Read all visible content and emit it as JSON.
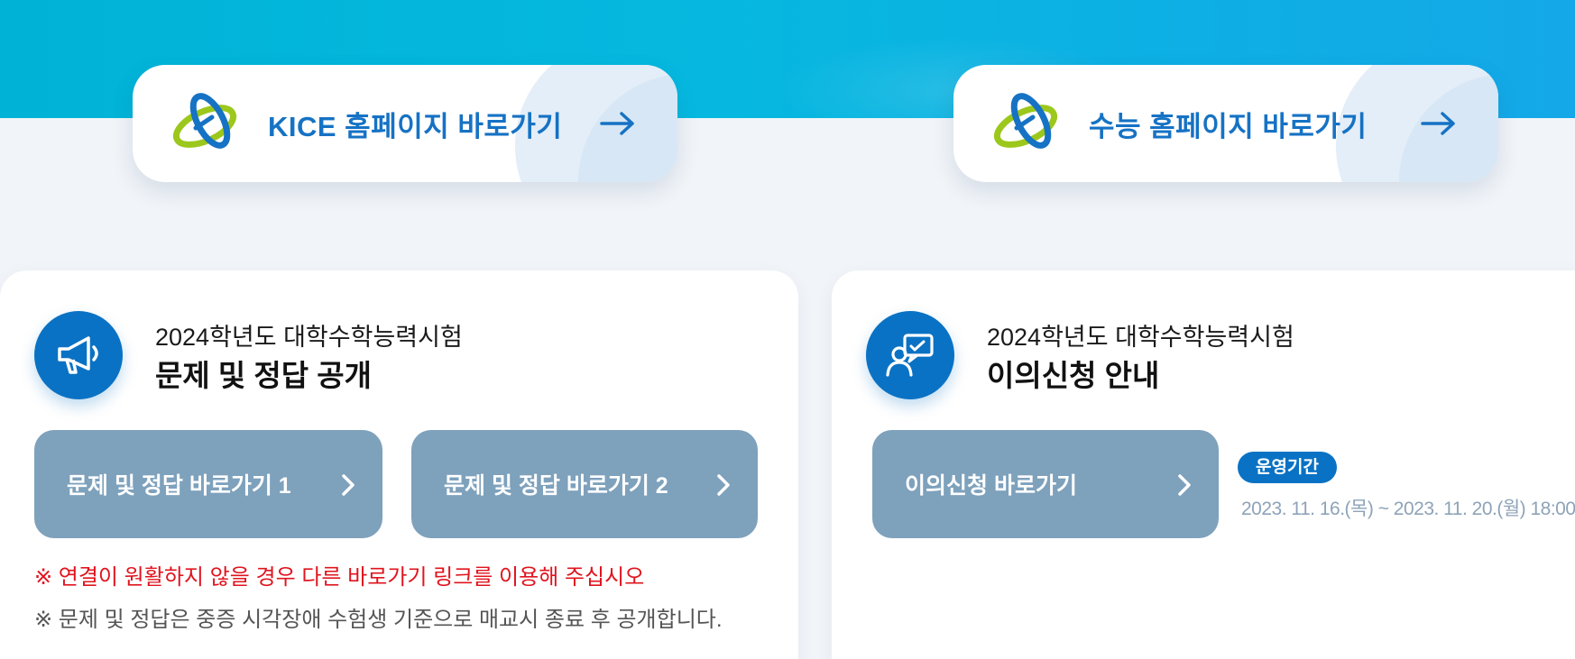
{
  "top_links": [
    {
      "label": "KICE 홈페이지 바로가기",
      "icon": "kice-logo-icon"
    },
    {
      "label": "수능 홈페이지 바로가기",
      "icon": "kice-logo-icon"
    }
  ],
  "panels": {
    "answers": {
      "subtitle": "2024학년도 대학수학능력시험",
      "title": "문제 및 정답 공개",
      "icon": "megaphone-icon",
      "buttons": [
        {
          "label": "문제 및 정답 바로가기 1"
        },
        {
          "label": "문제 및 정답 바로가기 2"
        }
      ],
      "notice_red": "※ 연결이 원활하지 않을 경우 다른 바로가기 링크를 이용해 주십시오",
      "notice_gray": "※ 문제 및 정답은 중증 시각장애 수험생 기준으로 매교시 종료 후 공개합니다."
    },
    "objection": {
      "subtitle": "2024학년도 대학수학능력시험",
      "title": "이의신청 안내",
      "icon": "consultation-icon",
      "button": {
        "label": "이의신청 바로가기"
      },
      "period_badge": "운영기간",
      "period_dates": "2023. 11. 16.(목) ~ 2023. 11. 20.(월) 18:00"
    }
  },
  "colors": {
    "primary_blue": "#0a72c4",
    "link_text": "#1672c4",
    "button_bg": "#7ea1bc",
    "notice_red": "#e0141e",
    "top_band": "#06b8df"
  }
}
